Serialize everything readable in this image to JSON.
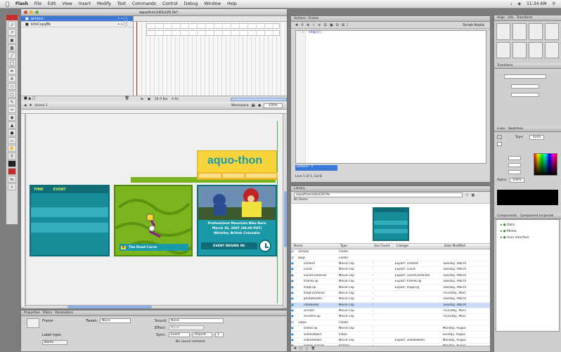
{
  "menubar": {
    "app_name": "Flash",
    "items": [
      "File",
      "Edit",
      "View",
      "Insert",
      "Modify",
      "Text",
      "Commands",
      "Control",
      "Debug",
      "Window",
      "Help"
    ],
    "clock": "11:34 AM"
  },
  "document": {
    "title": "aquothon14Oct20.fla*",
    "layers": [
      {
        "name": "actions"
      },
      {
        "name": "infoCopyBk"
      }
    ],
    "stage_tab": "Scene 1",
    "workspace_label": "Workspace",
    "zoom": "100%",
    "timeline_fps": "24.0 fps",
    "timeline_time": "0.0s"
  },
  "stage": {
    "logo_text": "aquo-thon",
    "card1": {
      "col1": "TIME",
      "col2": "EVENT"
    },
    "card2": {
      "badge": "1",
      "label": "The Road Curve"
    },
    "card3": {
      "line1": "Professional Mountain Bike Race",
      "line2": "March 26, 2007 (06:00 PST)",
      "line3": "Whistler, British Columbia",
      "cta": "EVENT BEGINS IN:"
    },
    "colors": {
      "teal": "#1a9aa8",
      "lime": "#7ab51d",
      "yellow": "#f7d43a",
      "stage_bg": "#efefef",
      "blue_accent": "#3b77d6"
    }
  },
  "actions_panel": {
    "tab": "Actions - Frame",
    "script_assist": "Script Assist",
    "code_line": "stop();",
    "status": "Line 1 of 1, Col 8",
    "footer_tab": "actions : 1"
  },
  "library_panel": {
    "tab": "Library",
    "doc_select": "aquothon14Oct20.fla",
    "count": "81 items",
    "columns": [
      "Name",
      "Type",
      "Use Count",
      "Linkage",
      "Date Modified"
    ],
    "rows": [
      {
        "name": "actions",
        "type": "Folder",
        "use": "",
        "link": "",
        "date": ""
      },
      {
        "name": "bkgs",
        "type": "Folder",
        "use": "",
        "link": "",
        "date": ""
      },
      {
        "name": "content",
        "type": "Movie Clip",
        "use": "-",
        "link": "Export: content",
        "date": "Tuesday, March"
      },
      {
        "name": "count",
        "type": "Movie Clip",
        "use": "-",
        "link": "Export: count",
        "date": "Tuesday, March"
      },
      {
        "name": "countContainer",
        "type": "Movie Clip",
        "use": "-",
        "link": "Export: countContainer",
        "date": "Tuesday, March"
      },
      {
        "name": "frameClip",
        "type": "Movie Clip",
        "use": "-",
        "link": "Export: frameClip",
        "date": "Tuesday, March"
      },
      {
        "name": "mapClip",
        "type": "Movie Clip",
        "use": "-",
        "link": "Export: mapClip",
        "date": "Tuesday, March"
      },
      {
        "name": "mapContainer",
        "type": "Movie Clip",
        "use": "-",
        "link": "",
        "date": "Thursday, Marc"
      },
      {
        "name": "photoHolder",
        "type": "Movie Clip",
        "use": "-",
        "link": "",
        "date": "Tuesday, March"
      },
      {
        "name": "infoHolder",
        "type": "Movie Clip",
        "use": "-",
        "link": "",
        "date": "Tuesday, March"
      },
      {
        "name": "scroller",
        "type": "Movie Clip",
        "use": "-",
        "link": "",
        "date": "Thursday, Marc"
      },
      {
        "name": "scrollerClip",
        "type": "Movie Clip",
        "use": "-",
        "link": "",
        "date": "Thursday, Marc"
      },
      {
        "name": "video",
        "type": "Folder",
        "use": "",
        "link": "",
        "date": ""
      },
      {
        "name": "videoClip",
        "type": "Movie Clip",
        "use": "-",
        "link": "",
        "date": "Monday, Augus"
      },
      {
        "name": "videoObject",
        "type": "Video",
        "use": "-",
        "link": "",
        "date": "Sunday, Augus"
      },
      {
        "name": "videoHolder",
        "type": "Movie Clip",
        "use": "-",
        "link": "Export: videoHolder",
        "date": "Monday, Augus"
      },
      {
        "name": "videoControls",
        "type": "Bitmap",
        "use": "-",
        "link": "",
        "date": "Monday, Augus"
      }
    ]
  },
  "properties_panel": {
    "tabs": [
      "Properties",
      "Filters",
      "Parameters"
    ],
    "frame_label": "Frame",
    "tween_label": "Tween:",
    "tween_value": "None",
    "sound_label": "Sound:",
    "sound_value": "None",
    "effect_label": "Effect:",
    "effect_value": "None",
    "sync_label": "Sync:",
    "sync_value": "Event",
    "repeat_value": "Repeat",
    "repeat_count": "1",
    "label_type": "Label type:",
    "label_value": "Name",
    "no_sound": "No sound selected"
  },
  "right_panels": {
    "align_tabs": [
      "Align",
      "Info",
      "Transform"
    ],
    "color_tabs": [
      "Color",
      "Swatches"
    ],
    "color_type_label": "Type:",
    "color_type": "Solid",
    "alpha_label": "Alpha:",
    "alpha_value": "100%",
    "components_tabs": [
      "Components",
      "Component Inspector"
    ],
    "components": [
      "Data",
      "Media",
      "User Interface"
    ]
  }
}
